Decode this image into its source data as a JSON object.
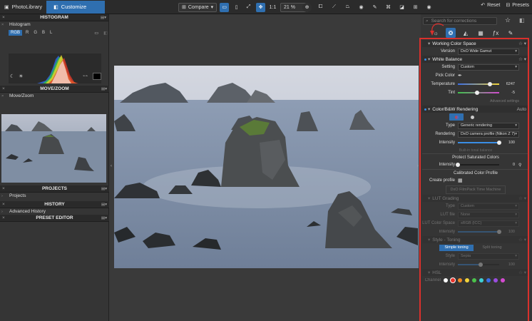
{
  "topbar": {
    "tabs": [
      {
        "label": "PhotoLibrary"
      },
      {
        "label": "Customize"
      }
    ],
    "compare_label": "Compare",
    "zoom_fit": "1:1",
    "zoom_value": "21 %",
    "reset_label": "Reset",
    "presets_label": "Presets"
  },
  "left": {
    "histogram_title": "HISTOGRAM",
    "histogram_sub": "Histogram",
    "channels": [
      "RGB",
      "R",
      "G",
      "B",
      "L"
    ],
    "movezoom_title": "MOVE/ZOOM",
    "movezoom_sub": "Move/Zoom",
    "projects_title": "PROJECTS",
    "projects_sub": "Projects",
    "history_title": "HISTORY",
    "history_sub": "Advanced History",
    "preset_title": "PRESET EDITOR"
  },
  "right": {
    "search_placeholder": "Search for corrections",
    "wcs": {
      "title": "Working Color Space",
      "version_label": "Version",
      "version_value": "DxO Wide Gamut"
    },
    "wb": {
      "title": "White Balance",
      "setting_label": "Setting",
      "setting_value": "Custom",
      "pick_label": "Pick Color",
      "temp_label": "Temperature",
      "temp_value": "6247",
      "temp_pct": 0.78,
      "tint_label": "Tint",
      "tint_value": "-5",
      "tint_pct": 0.47,
      "advanced": "Advanced settings"
    },
    "cbw": {
      "title": "Color/B&W Rendering",
      "auto": "Auto",
      "type_label": "Type",
      "type_value": "Generic rendering",
      "rendering_label": "Rendering",
      "rendering_value": "DxO camera profile (Nikon Z 7)",
      "intensity_label": "Intensity",
      "intensity_value": "100",
      "intensity_pct": 1.0,
      "built_in": "Built-in tonal balance"
    },
    "psc": {
      "title": "Protect Saturated Colors",
      "intensity_label": "Intensity",
      "intensity_value": "0",
      "intensity_pct": 0.0
    },
    "ccp": {
      "title": "Calibrated Color Profile",
      "create_label": "Create profile",
      "machine": "DxO FilmPack Time Machine"
    },
    "lut": {
      "title": "LUT Grading",
      "type_label": "Type",
      "type_value": "Custom",
      "file_label": "LUT file",
      "file_value": "None",
      "cs_label": "LUT Color Space",
      "cs_value": "sRGB (ICC)",
      "intensity_label": "Intensity",
      "intensity_value": "100",
      "intensity_pct": 1.0
    },
    "style": {
      "title": "Style - Toning",
      "simple": "Simple toning",
      "split": "Split toning",
      "style_label": "Style",
      "style_value": "Sepia",
      "intensity_label": "Intensity",
      "intensity_value": "100",
      "intensity_pct": 0.55
    },
    "hsl": {
      "title": "HSL",
      "channel_label": "Channel",
      "colors": [
        "#ffffff",
        "#e8332b",
        "#f08a24",
        "#f2d33a",
        "#4bc24b",
        "#3fd0d6",
        "#3a6ee6",
        "#9b4de0",
        "#d34ad0"
      ]
    }
  }
}
